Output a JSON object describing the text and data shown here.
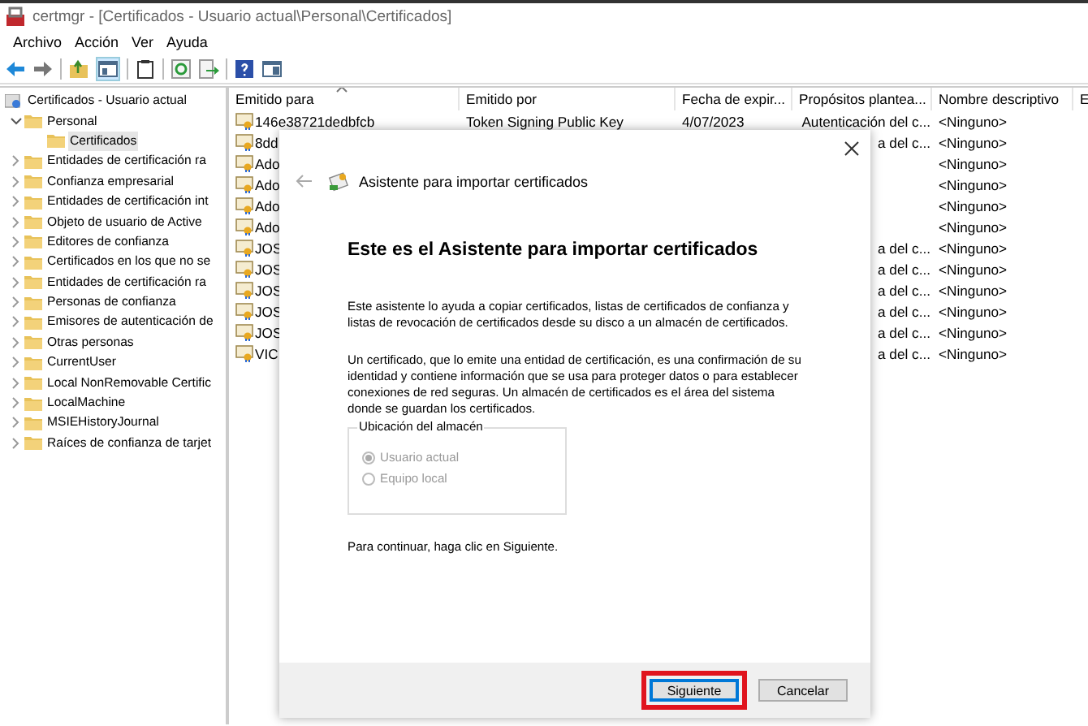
{
  "window": {
    "title": "certmgr - [Certificados - Usuario actual\\Personal\\Certificados]"
  },
  "menu": [
    "Archivo",
    "Acción",
    "Ver",
    "Ayuda"
  ],
  "tree": {
    "label": "Certificados - Usuario actual",
    "children": [
      {
        "label": "Personal",
        "expanded": true,
        "selected": false,
        "children": [
          {
            "label": "Certificados",
            "selected": true
          }
        ]
      },
      {
        "label": "Entidades de certificación ra",
        "expanded": false,
        "selected": false
      },
      {
        "label": "Confianza empresarial",
        "expanded": false,
        "selected": false
      },
      {
        "label": "Entidades de certificación int",
        "expanded": false,
        "selected": false
      },
      {
        "label": "Objeto de usuario de Active",
        "expanded": false,
        "selected": false
      },
      {
        "label": "Editores de confianza",
        "expanded": false,
        "selected": false
      },
      {
        "label": "Certificados en los que no se",
        "expanded": false,
        "selected": false
      },
      {
        "label": "Entidades de certificación ra",
        "expanded": false,
        "selected": false
      },
      {
        "label": "Personas de confianza",
        "expanded": false,
        "selected": false
      },
      {
        "label": "Emisores de autenticación de",
        "expanded": false,
        "selected": false
      },
      {
        "label": "Otras personas",
        "expanded": false,
        "selected": false
      },
      {
        "label": "CurrentUser",
        "expanded": false,
        "selected": false
      },
      {
        "label": "Local NonRemovable Certific",
        "expanded": false,
        "selected": false
      },
      {
        "label": "LocalMachine",
        "expanded": false,
        "selected": false
      },
      {
        "label": "MSIEHistoryJournal",
        "expanded": false,
        "selected": false
      },
      {
        "label": "Raíces de confianza de tarjet",
        "expanded": false,
        "selected": false
      }
    ]
  },
  "table": {
    "columns": [
      "Emitido para",
      "Emitido por",
      "Fecha de expir...",
      "Propósitos plantea...",
      "Nombre descriptivo",
      "E"
    ],
    "rows": [
      {
        "issued_to": "146e38721dedbfcb",
        "issued_by": "Token Signing Public Key",
        "expiration": "4/07/2023",
        "purposes": "Autenticación del c...",
        "friendly_name": "<Ninguno>"
      },
      {
        "issued_to": "8dd",
        "purposes": "a del c...",
        "friendly_name": "<Ninguno>"
      },
      {
        "issued_to": "Ado",
        "friendly_name": "<Ninguno>"
      },
      {
        "issued_to": "Ado",
        "friendly_name": "<Ninguno>"
      },
      {
        "issued_to": "Ado",
        "friendly_name": "<Ninguno>"
      },
      {
        "issued_to": "Ado",
        "friendly_name": "<Ninguno>"
      },
      {
        "issued_to": "JOS",
        "purposes": "a del c...",
        "friendly_name": "<Ninguno>"
      },
      {
        "issued_to": "JOS",
        "purposes": "a del c...",
        "friendly_name": "<Ninguno>"
      },
      {
        "issued_to": "JOS",
        "purposes": "a del c...",
        "friendly_name": "<Ninguno>"
      },
      {
        "issued_to": "JOS",
        "purposes": "a del c...",
        "friendly_name": "<Ninguno>"
      },
      {
        "issued_to": "JOS",
        "purposes": "a del c...",
        "friendly_name": "<Ninguno>"
      },
      {
        "issued_to": "VIC",
        "purposes": "a del c...",
        "friendly_name": "<Ninguno>"
      }
    ]
  },
  "dialog": {
    "title": "Asistente para importar certificados",
    "heading": "Este es el Asistente para importar certificados",
    "paragraphs": [
      "Este asistente lo ayuda a copiar certificados, listas de certificados de confianza y listas de revocación de certificados desde su disco a un almacén de certificados.",
      "Un certificado, que lo emite una entidad de certificación, es una confirmación de su identidad y contiene información que se usa para proteger datos o para establecer conexiones de red seguras. Un almacén de certificados es el área del sistema donde se guardan los certificados."
    ],
    "store_group": {
      "label": "Ubicación del almacén",
      "options": [
        {
          "label": "Usuario actual",
          "selected": true,
          "disabled": true
        },
        {
          "label": "Equipo local",
          "selected": false,
          "disabled": true
        }
      ]
    },
    "hint": "Para continuar, haga clic en Siguiente.",
    "buttons": [
      {
        "label": "Siguiente",
        "default": true,
        "highlighted": true
      },
      {
        "label": "Cancelar",
        "default": false,
        "highlighted": false
      }
    ]
  }
}
